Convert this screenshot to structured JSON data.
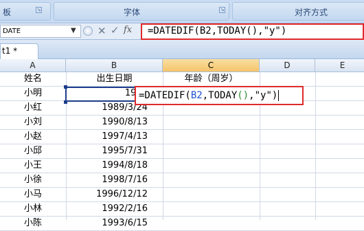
{
  "ribbon": {
    "groups": [
      {
        "label": "板"
      },
      {
        "label": "字体"
      },
      {
        "label": "对齐方式"
      }
    ]
  },
  "formula_bar": {
    "name_box": "DATE",
    "formula": "=DATEDIF(B2,TODAY(),\"y\")",
    "fx_label": "fx"
  },
  "sheet_tab": {
    "label": "t1 *"
  },
  "columns": [
    "A",
    "B",
    "C",
    "D",
    "E"
  ],
  "rows": [
    {
      "name": "姓名",
      "date": "出生日期",
      "c": "年龄（周岁）"
    },
    {
      "name": "小明",
      "date": "1999",
      "c": ""
    },
    {
      "name": "小红",
      "date": "1989/3/24",
      "c": ""
    },
    {
      "name": "小刘",
      "date": "1990/8/13",
      "c": ""
    },
    {
      "name": "小赵",
      "date": "1997/4/13",
      "c": ""
    },
    {
      "name": "小邱",
      "date": "1995/7/31",
      "c": ""
    },
    {
      "name": "小王",
      "date": "1994/8/18",
      "c": ""
    },
    {
      "name": "小徐",
      "date": "1998/7/16",
      "c": ""
    },
    {
      "name": "小马",
      "date": "1996/12/12",
      "c": ""
    },
    {
      "name": "小林",
      "date": "1992/2/16",
      "c": ""
    },
    {
      "name": "小陈",
      "date": "1993/6/15",
      "c": ""
    }
  ],
  "in_cell_edit": {
    "prefix": "=DATEDIF(",
    "ref": "B2",
    "mid1": ",TODAY",
    "paren": "()",
    "mid2": ",",
    "arg": "\"y\"",
    "close": ")"
  },
  "colors": {
    "highlight": "#e0292b",
    "ref_blue": "#1f4fd0",
    "selected_col": "#f5c46a"
  }
}
